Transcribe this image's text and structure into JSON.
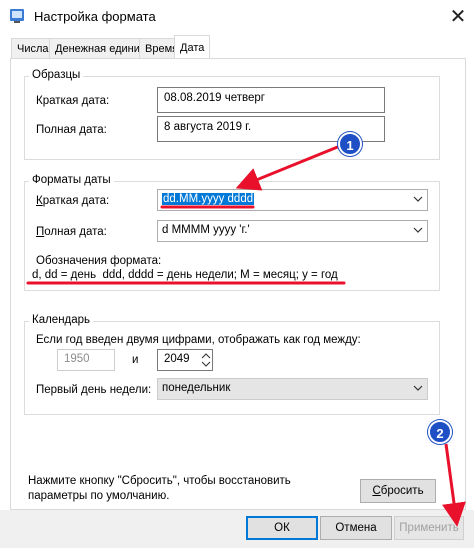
{
  "window": {
    "title": "Настройка формата"
  },
  "tabs": [
    {
      "label": "Числа"
    },
    {
      "label": "Денежная единица"
    },
    {
      "label": "Время"
    },
    {
      "label": "Дата"
    }
  ],
  "samples": {
    "group_label": "Образцы",
    "short_label": "Краткая дата:",
    "short_value": "08.08.2019 четверг",
    "long_label": "Полная дата:",
    "long_value": "8 августа 2019 г."
  },
  "formats": {
    "group_label": "Форматы даты",
    "short_label": "Краткая дата:",
    "short_value": "dd.MM.yyyy dddd",
    "long_label": "Полная дата:",
    "long_value": "d MMMM yyyy 'г.'",
    "notation_title": "Обозначения формата:",
    "notation_text": "d, dd = день  ddd, dddd = день недели; M = месяц; y = год"
  },
  "calendar": {
    "group_label": "Календарь",
    "two_digit_label": "Если год введен двумя цифрами, отображать как год между:",
    "year_from": "1950",
    "and_label": "и",
    "year_to": "2049",
    "first_day_label": "Первый день недели:",
    "first_day_value": "понедельник"
  },
  "reset": {
    "hint_line1": "Нажмите кнопку \"Сбросить\", чтобы восстановить",
    "hint_line2": "параметры по умолчанию.",
    "button": "Сбросить"
  },
  "buttons": {
    "ok": "ОК",
    "cancel": "Отмена",
    "apply": "Применить"
  },
  "annotations": {
    "badge1": "1",
    "badge2": "2",
    "accent_color": "#e8102a",
    "badge_color": "#1f4fc4"
  }
}
